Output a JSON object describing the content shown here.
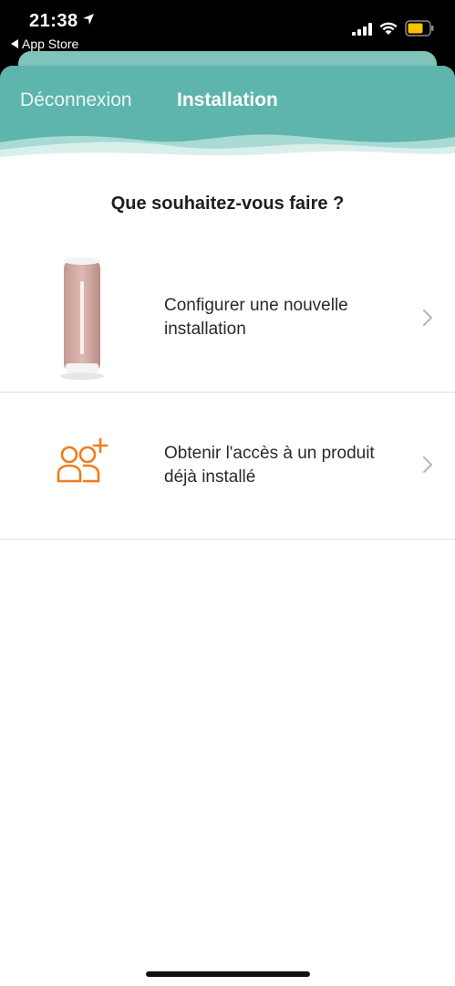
{
  "status_bar": {
    "time": "21:38",
    "back_app": "App Store",
    "location_icon": "location-arrow-icon",
    "signal_icon": "cellular-signal-icon",
    "wifi_icon": "wifi-icon",
    "battery_icon": "battery-icon",
    "battery_color": "#f5c400"
  },
  "header": {
    "tabs": [
      {
        "label": "Déconnexion",
        "active": false
      },
      {
        "label": "Installation",
        "active": true
      }
    ],
    "color": "#5db5ad"
  },
  "main": {
    "question": "Que souhaitez-vous faire ?",
    "options": [
      {
        "label": "Configurer une nouvelle installation",
        "icon": "smart-indoor-monitor-device-image",
        "chevron": "chevron-right-icon"
      },
      {
        "label": "Obtenir l'accès à un produit déjà installé",
        "icon": "add-users-icon",
        "chevron": "chevron-right-icon"
      }
    ],
    "accent_color": "#ef7d1a"
  }
}
